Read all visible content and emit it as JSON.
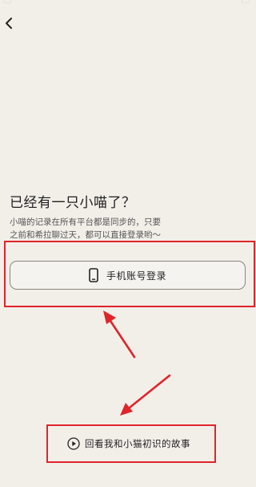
{
  "header": {
    "back_icon": "chevron-left-icon"
  },
  "intro": {
    "heading": "已经有一只小喵了？",
    "description_line1": "小喵的记录在所有平台都是同步的，只要",
    "description_line2": "之前和希拉聊过天，都可以直接登录哟～"
  },
  "login": {
    "phone_label": "手机账号登录",
    "phone_icon": "smartphone-icon"
  },
  "story": {
    "label": "回看我和小猫初识的故事",
    "icon": "play-circle-icon"
  },
  "colors": {
    "background": "#f2efe9",
    "annotation": "#e0242a",
    "button_border": "#8a8580"
  }
}
